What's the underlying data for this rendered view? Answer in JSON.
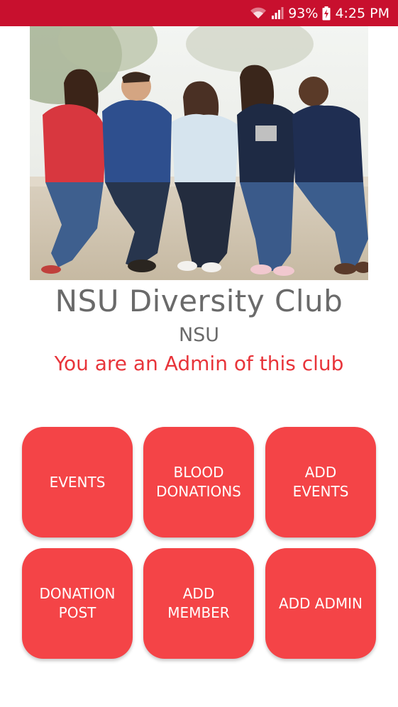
{
  "status_bar": {
    "battery": "93%",
    "time": "4:25 PM",
    "icons": [
      "wifi-icon",
      "signal-icon",
      "battery-charging-icon"
    ],
    "background": "#c8102e"
  },
  "banner": {
    "description_icon": "group-photo-image"
  },
  "club": {
    "name": "NSU Diversity Club",
    "org": "NSU",
    "admin_note": "You are an Admin of this club"
  },
  "actions": {
    "events": "EVENTS",
    "blood_donations": "BLOOD\nDONATIONS",
    "add_events": "ADD\nEVENTS",
    "donation_post": "DONATION\nPOST",
    "add_member": "ADD\nMEMBER",
    "add_admin": "ADD ADMIN"
  },
  "colors": {
    "accent": "#f44447",
    "admin_text": "#e8343a",
    "title_text": "#6a6a6a"
  }
}
